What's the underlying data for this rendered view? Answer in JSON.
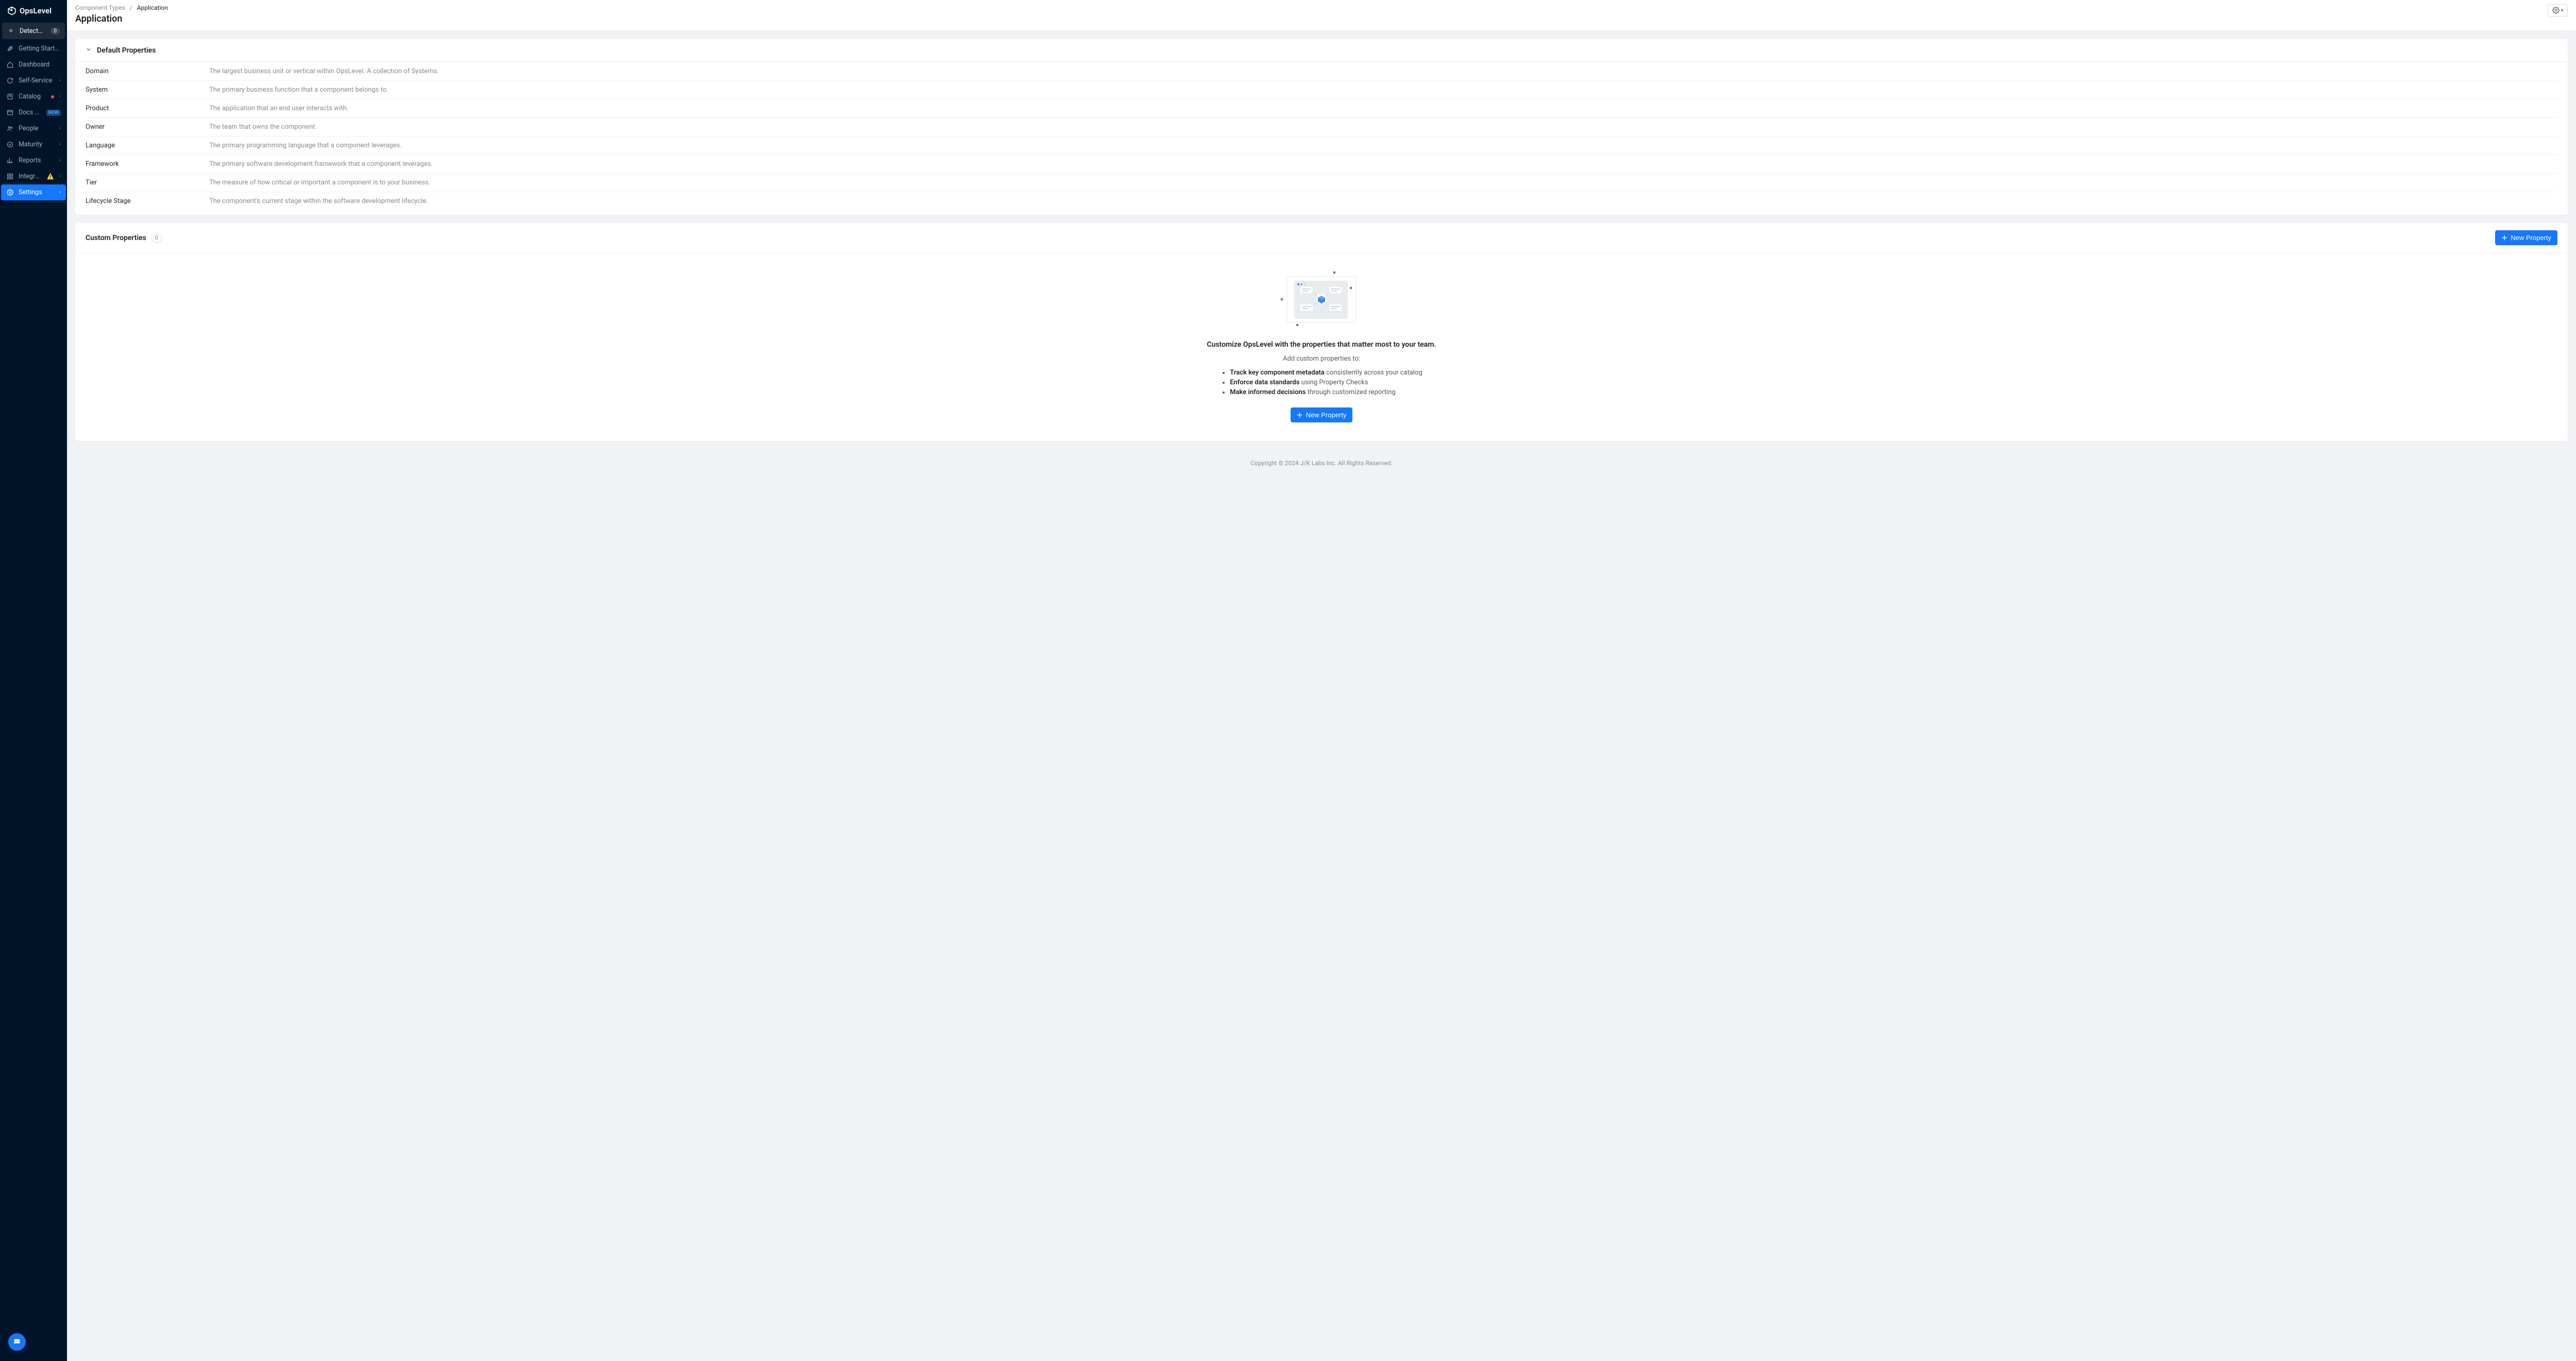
{
  "brand": {
    "name": "OpsLevel"
  },
  "sidebar": {
    "detected": {
      "label": "Detected Services",
      "count": "0"
    },
    "items": [
      {
        "label": "Getting Started"
      },
      {
        "label": "Dashboard"
      },
      {
        "label": "Self-Service"
      },
      {
        "label": "Catalog"
      },
      {
        "label": "Docs Hub",
        "tag": "NEW"
      },
      {
        "label": "People"
      },
      {
        "label": "Maturity"
      },
      {
        "label": "Reports"
      },
      {
        "label": "Integrations"
      },
      {
        "label": "Settings"
      }
    ]
  },
  "breadcrumb": {
    "parent": "Component Types",
    "sep": "/",
    "current": "Application"
  },
  "page_title": "Application",
  "default_section": {
    "title": "Default Properties",
    "rows": [
      {
        "name": "Domain",
        "desc": "The largest business unit or vertical within OpsLevel. A collection of Systems."
      },
      {
        "name": "System",
        "desc": "The primary business function that a component belongs to."
      },
      {
        "name": "Product",
        "desc": "The application that an end user interacts with."
      },
      {
        "name": "Owner",
        "desc": "The team that owns the component."
      },
      {
        "name": "Language",
        "desc": "The primary programming language that a component leverages."
      },
      {
        "name": "Framework",
        "desc": "The primary software development framework that a component leverages."
      },
      {
        "name": "Tier",
        "desc": "The measure of how critical or important a component is to your business."
      },
      {
        "name": "Lifecycle Stage",
        "desc": "The component's current stage within the software development lifecycle."
      }
    ]
  },
  "custom_section": {
    "title": "Custom Properties",
    "count": "0",
    "new_button": "New Property",
    "empty": {
      "headline": "Customize OpsLevel with the properties that matter most to your team.",
      "lead": "Add custom properties to:",
      "bullets": [
        {
          "bold": "Track key component metadata",
          "rest": " consistently across your catalog"
        },
        {
          "bold": "Enforce data standards",
          "rest": " using Property Checks"
        },
        {
          "bold": "Make informed decisions",
          "rest": " through customized reporting"
        }
      ],
      "cta": "New Property"
    }
  },
  "footer": "Copyright © 2024 J/K Labs Inc. All Rights Reserved."
}
